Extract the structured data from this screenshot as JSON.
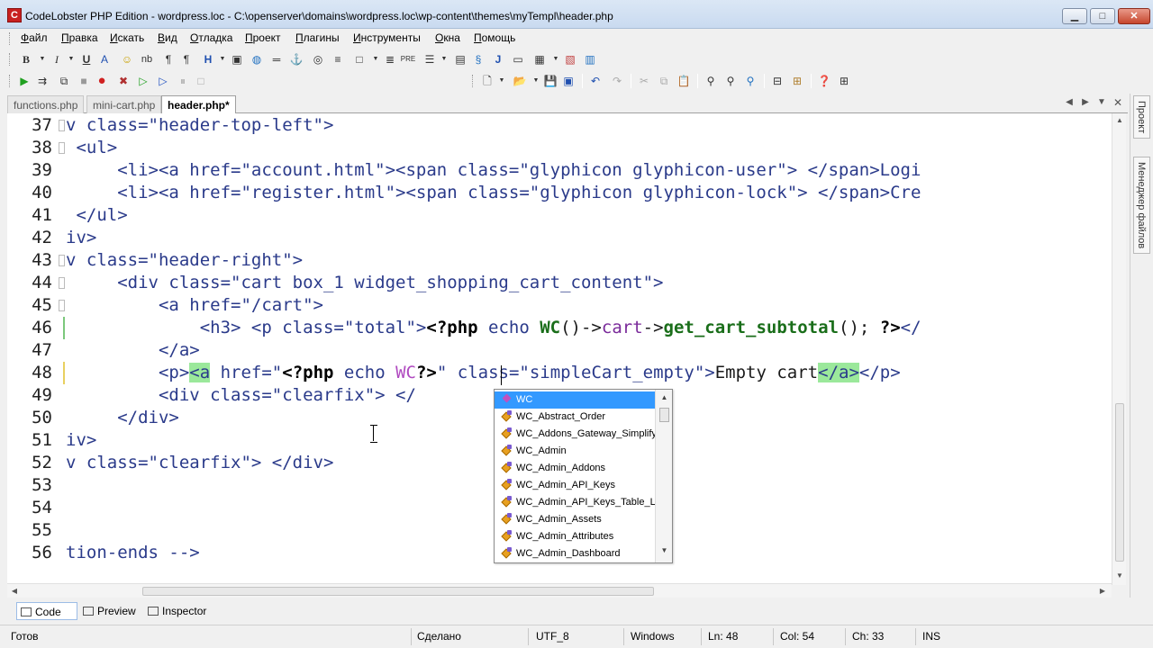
{
  "window": {
    "title": "CodeLobster PHP Edition - wordpress.loc - C:\\openserver\\domains\\wordpress.loc\\wp-content\\themes\\myTempl\\header.php",
    "app_icon": "codelobster-logo-icon",
    "minimize": "▁",
    "maximize": "□",
    "close": "✕"
  },
  "menu": [
    {
      "label": "Файл",
      "u": "Ф",
      "rest": "айл"
    },
    {
      "label": "Правка",
      "u": "П",
      "rest": "равка"
    },
    {
      "label": "Искать",
      "u": "И",
      "rest": "скать"
    },
    {
      "label": "Вид",
      "u": "В",
      "rest": "ид"
    },
    {
      "label": "Отладка",
      "u": "О",
      "rest": "тладка"
    },
    {
      "label": "Проект",
      "u": "П",
      "rest": "роект"
    },
    {
      "label": "Плагины",
      "u": "П",
      "rest": "лагины"
    },
    {
      "label": "Инструменты",
      "u": "И",
      "rest": "нструменты"
    },
    {
      "label": "Окна",
      "u": "О",
      "rest": "кна"
    },
    {
      "label": "Помощь",
      "u": "П",
      "rest": "омощь"
    }
  ],
  "tabs": [
    {
      "label": "functions.php",
      "active": false
    },
    {
      "label": "mini-cart.php",
      "active": false
    },
    {
      "label": "header.php*",
      "active": true
    }
  ],
  "side_panel": [
    "Проект",
    "Менеджер файлов"
  ],
  "editor": {
    "lines": [
      {
        "n": "37"
      },
      {
        "n": "38"
      },
      {
        "n": "39"
      },
      {
        "n": "40"
      },
      {
        "n": "41"
      },
      {
        "n": "42"
      },
      {
        "n": "43"
      },
      {
        "n": "44"
      },
      {
        "n": "45"
      },
      {
        "n": "46"
      },
      {
        "n": "47"
      },
      {
        "n": "48"
      },
      {
        "n": "49"
      },
      {
        "n": "50"
      },
      {
        "n": "51"
      },
      {
        "n": "52"
      },
      {
        "n": "53"
      },
      {
        "n": "54"
      },
      {
        "n": "55"
      },
      {
        "n": "56"
      }
    ],
    "code": {
      "l37": "v class=\"header-top-left\">",
      "l38": " <ul>",
      "l39a": "     <li><a href=\"account.html\"><span class=\"glyphicon glyphicon-user\"> </span>Logi",
      "l40a": "     <li><a href=\"register.html\"><span class=\"glyphicon glyphicon-lock\"> </span>Cre",
      "l41": " </ul>",
      "l42": "iv>",
      "l43": "v class=\"header-right\">",
      "l44": "     <div class=\"cart box_1 widget_shopping_cart_content\">",
      "l45": "         <a href=\"/cart\">",
      "l46_pre": "             <h3> <p class=\"total\">",
      "l46_php1": "<?php",
      "l46_echo": " echo ",
      "l46_wc": "WC",
      "l46_mid": "()->",
      "l46_cart": "cart",
      "l46_arrow": "->",
      "l46_fn": "get_cart_subtotal",
      "l46_end": "(); ",
      "l46_close": "?>",
      "l46_tail": "</",
      "l47": "         </a>",
      "l48_pre": "         <p>",
      "l48_a": "<a",
      "l48_href": " href=\"",
      "l48_php": "<?php",
      "l48_echo": " echo ",
      "l48_wc": "WC",
      "l48_close": "?>",
      "l48_rest": "\" class=\"simpleCart_empty\">",
      "l48_text": "Empty cart",
      "l48_ea": "</a>",
      "l48_ep": "</p>",
      "l49": "         <div class=\"clearfix\"> </",
      "l50": "     </div>",
      "l51": "iv>",
      "l52": "v class=\"clearfix\"> </div>",
      "l53": "",
      "l54": "",
      "l55": "",
      "l56": "tion-ends -->"
    }
  },
  "autocomplete": {
    "items": [
      {
        "label": "WC",
        "kind": "function",
        "selected": true
      },
      {
        "label": "WC_Abstract_Order",
        "kind": "class"
      },
      {
        "label": "WC_Addons_Gateway_Simplify_",
        "kind": "class"
      },
      {
        "label": "WC_Admin",
        "kind": "class"
      },
      {
        "label": "WC_Admin_Addons",
        "kind": "class"
      },
      {
        "label": "WC_Admin_API_Keys",
        "kind": "class"
      },
      {
        "label": "WC_Admin_API_Keys_Table_L",
        "kind": "class"
      },
      {
        "label": "WC_Admin_Assets",
        "kind": "class"
      },
      {
        "label": "WC_Admin_Attributes",
        "kind": "class"
      },
      {
        "label": "WC_Admin_Dashboard",
        "kind": "class"
      }
    ]
  },
  "view_tabs": [
    {
      "label": "Code",
      "icon": "code-view-icon",
      "active": true
    },
    {
      "label": "Preview",
      "icon": "preview-icon",
      "active": false
    },
    {
      "label": "Inspector",
      "icon": "inspector-icon",
      "active": false
    }
  ],
  "status": {
    "ready": "Готов",
    "done": "Сделано",
    "encoding": "UTF_8",
    "eol": "Windows",
    "line": "Ln: 48",
    "col": "Col: 54",
    "ch": "Ch: 33",
    "mode": "INS"
  },
  "colors": {
    "selection": "#3399ff",
    "php_highlight": "#9be89b",
    "html_tag": "#2a3a8a"
  }
}
